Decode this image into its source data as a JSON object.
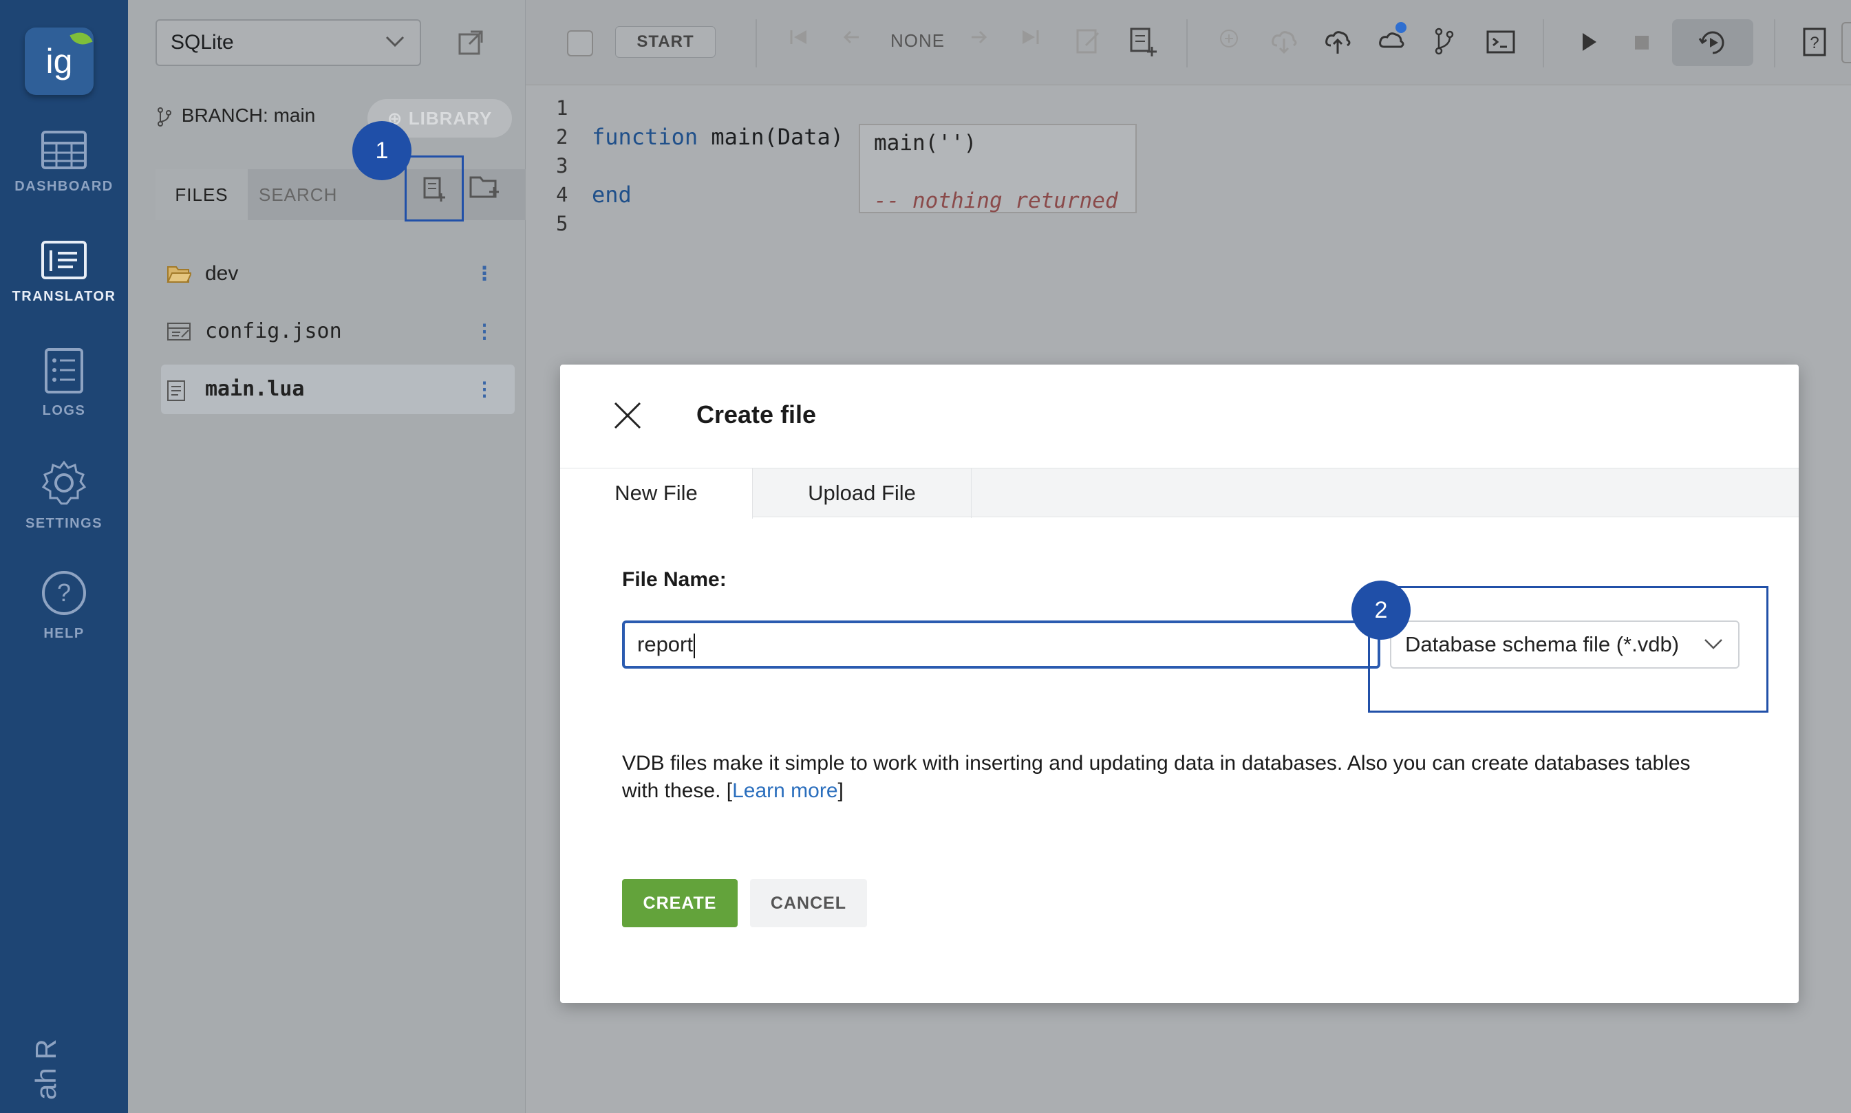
{
  "app": {
    "logo_text": "ig"
  },
  "nav": [
    {
      "label": "DASHBOARD",
      "icon": "dashboard-icon"
    },
    {
      "label": "TRANSLATOR",
      "icon": "translator-icon",
      "active": true
    },
    {
      "label": "LOGS",
      "icon": "logs-icon"
    },
    {
      "label": "SETTINGS",
      "icon": "gear-icon"
    },
    {
      "label": "HELP",
      "icon": "help-icon"
    }
  ],
  "nav_bottom_text": "ah R",
  "sidebar": {
    "db_select": "SQLite",
    "branch_label": "BRANCH:",
    "branch_value": "main",
    "library_label": "LIBRARY",
    "tabs": [
      "FILES",
      "SEARCH"
    ],
    "files": [
      {
        "name": "dev",
        "icon": "folder-icon"
      },
      {
        "name": "config.json",
        "icon": "json-file-icon"
      },
      {
        "name": "main.lua",
        "icon": "lua-file-icon",
        "selected": true
      }
    ]
  },
  "toolbar": {
    "start_label": "START",
    "none_label": "NONE"
  },
  "editor": {
    "line_numbers": [
      "1",
      "2",
      "3",
      "4",
      "5"
    ],
    "line2_kw": "function",
    "line2_rest": " main(Data)",
    "line4_kw": "end",
    "annotation_call": "main('')",
    "annotation_result": "-- nothing returned"
  },
  "markers": [
    "1",
    "2"
  ],
  "dialog": {
    "title": "Create file",
    "tabs": [
      "New File",
      "Upload File"
    ],
    "file_name_label": "File Name:",
    "file_name_value": "report",
    "file_type": "Database schema file (*.vdb)",
    "description": "VDB files make it simple to work with inserting and updating data in databases. Also you can create databases tables with these.",
    "learn_more_prefix": "[",
    "learn_more": "Learn more",
    "learn_more_suffix": "]",
    "create_label": "CREATE",
    "cancel_label": "CANCEL"
  },
  "colors": {
    "nav_bg": "#1e4574",
    "accent_blue": "#2150a8",
    "create_green": "#63a33b",
    "link": "#2a6ebd"
  }
}
